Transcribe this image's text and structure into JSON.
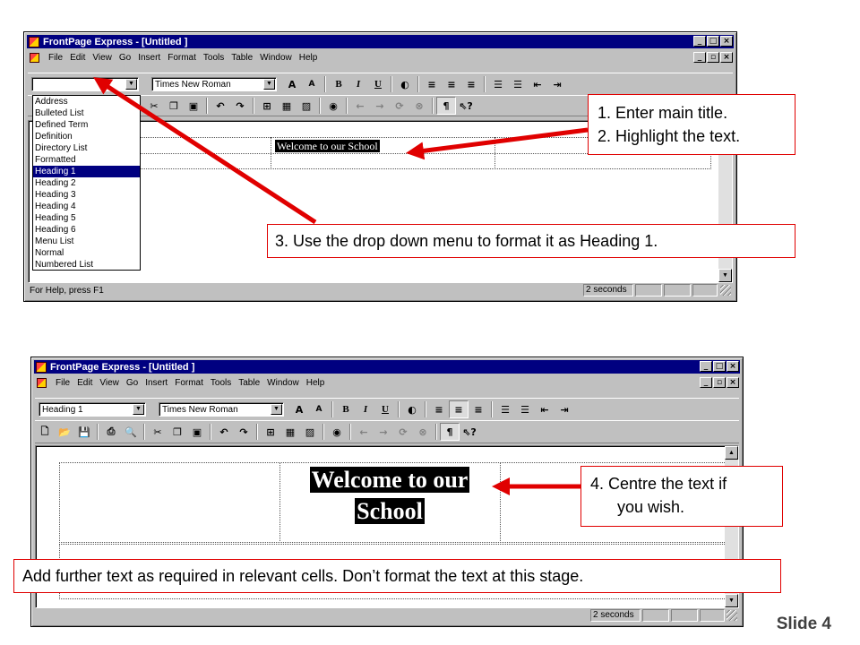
{
  "window": {
    "title": "FrontPage Express - [Untitled ]",
    "menus": [
      "File",
      "Edit",
      "View",
      "Go",
      "Insert",
      "Format",
      "Tools",
      "Table",
      "Window",
      "Help"
    ],
    "font_name": "Times New Roman",
    "status_help": "For Help, press F1",
    "status_time": "2 seconds"
  },
  "top": {
    "style_value": "",
    "style_options": [
      "Address",
      "Bulleted List",
      "Defined Term",
      "Definition",
      "Directory List",
      "Formatted",
      "Heading 1",
      "Heading 2",
      "Heading 3",
      "Heading 4",
      "Heading 5",
      "Heading 6",
      "Menu List",
      "Normal",
      "Numbered List"
    ],
    "selected_option": "Heading 1",
    "content_text": "Welcome to our School"
  },
  "bottom": {
    "style_value": "Heading 1",
    "content_line1": "Welcome to our",
    "content_line2": "School"
  },
  "callouts": {
    "c1_line1": "1. Enter main title.",
    "c1_line2": "2. Highlight the text.",
    "c3": "3. Use the drop down menu to format it as Heading 1.",
    "c4_line1": "4. Centre the text if",
    "c4_line2": "you wish.",
    "c5": "Add further text as required in relevant cells. Don’t format the text at this stage."
  },
  "slide": {
    "label": "Slide 4"
  },
  "icons": {
    "app": "frontpage-icon",
    "minimize": "minimize-icon",
    "maximize": "maximize-icon",
    "close": "close-icon",
    "dropdown": "chevron-down-icon"
  },
  "colors": {
    "titlebar": "#000080",
    "arrow": "#e00000",
    "chrome": "#c0c0c0"
  }
}
